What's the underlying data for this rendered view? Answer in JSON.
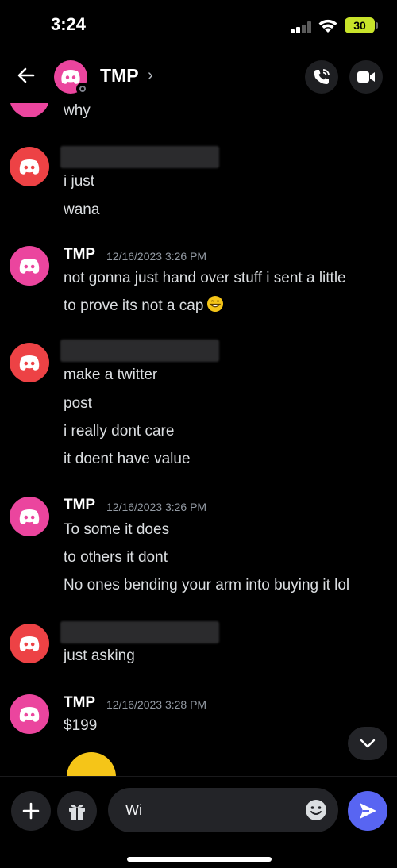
{
  "status_bar": {
    "time": "3:24",
    "battery": "30"
  },
  "header": {
    "title": "TMP",
    "chevron": "›",
    "back_icon": "arrow-left-icon",
    "call_icon": "phone-call-icon",
    "video_icon": "video-camera-icon"
  },
  "colors": {
    "pink_avatar": "#eb459e",
    "red_avatar": "#ed4245",
    "send_button": "#5865f2",
    "battery": "#c8e32a"
  },
  "messages": [
    {
      "author": "",
      "timestamp": "",
      "lines": [
        "why"
      ],
      "avatar": "pink"
    },
    {
      "author": "",
      "timestamp": "",
      "lines": [
        "i just",
        "wana"
      ],
      "avatar": "red"
    },
    {
      "author": "TMP",
      "timestamp": "12/16/2023 3:26 PM",
      "lines": [
        "not gonna just hand over stuff i sent a little",
        "to prove its not a cap"
      ],
      "avatar": "pink",
      "emoji": "grinning-face"
    },
    {
      "author": "",
      "timestamp": "",
      "lines": [
        "make a twitter",
        "post",
        "i really dont care",
        "it doent have value"
      ],
      "avatar": "red"
    },
    {
      "author": "TMP",
      "timestamp": "12/16/2023 3:26 PM",
      "lines": [
        "To some it does",
        "to others it dont",
        "No ones bending your arm into buying it lol"
      ],
      "avatar": "pink"
    },
    {
      "author": "",
      "timestamp": "",
      "lines": [
        "just asking"
      ],
      "avatar": "red"
    },
    {
      "author": "TMP",
      "timestamp": "12/16/2023 3:28 PM",
      "lines": [
        "$199"
      ],
      "avatar": "pink"
    }
  ],
  "composer": {
    "input_value": "Wi",
    "plus_icon": "plus-icon",
    "gift_icon": "gift-icon",
    "emoji_icon": "smiley-icon",
    "send_icon": "send-arrow-icon"
  }
}
